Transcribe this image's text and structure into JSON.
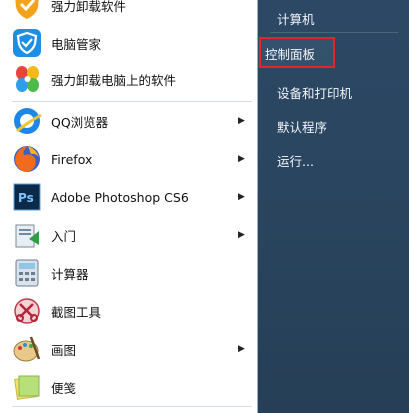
{
  "left_menu": {
    "items": [
      {
        "label": "强力卸载软件",
        "icon": "uninstall-shield-icon"
      },
      {
        "label": "电脑管家",
        "icon": "pc-manager-shield-icon"
      },
      {
        "label": "强力卸载电脑上的软件",
        "icon": "pinwheel-icon"
      },
      {
        "label": "QQ浏览器",
        "icon": "qq-browser-icon",
        "arrow": "▶"
      },
      {
        "label": "Firefox",
        "icon": "firefox-icon",
        "arrow": "▶"
      },
      {
        "label": "Adobe Photoshop CS6",
        "icon": "photoshop-icon",
        "arrow": "▶",
        "icon_text": "Ps"
      },
      {
        "label": "入门",
        "icon": "getting-started-icon",
        "arrow": "▶"
      },
      {
        "label": "计算器",
        "icon": "calculator-icon"
      },
      {
        "label": "截图工具",
        "icon": "snipping-tool-icon"
      },
      {
        "label": "画图",
        "icon": "paint-icon",
        "arrow": "▶"
      },
      {
        "label": "便笺",
        "icon": "sticky-notes-icon"
      }
    ]
  },
  "right_menu": {
    "items": [
      {
        "label": "计算机"
      },
      {
        "label": "控制面板",
        "highlighted": true
      },
      {
        "label": "设备和打印机"
      },
      {
        "label": "默认程序"
      },
      {
        "label": "运行..."
      }
    ]
  },
  "colors": {
    "highlight_border": "#e0252b",
    "right_panel": "#2a455f"
  }
}
